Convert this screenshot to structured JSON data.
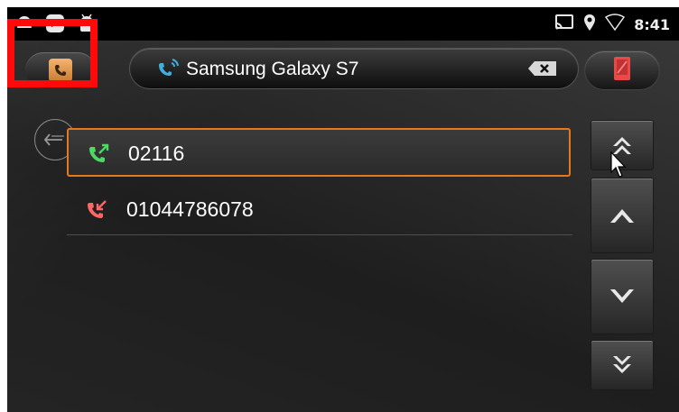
{
  "status_bar": {
    "time": "8:41",
    "left_icons": [
      "notification-icon",
      "app-icon",
      "android-icon"
    ],
    "right_icons": [
      "cast-icon",
      "location-icon",
      "wifi-icon"
    ]
  },
  "toolbar": {
    "device_name": "Samsung Galaxy S7",
    "contacts_icon": "contacts-phone-icon",
    "bluetooth_icon": "bluetooth-call-icon",
    "clear_icon": "backspace-icon",
    "phone_icon": "phone-device-icon"
  },
  "call_log": [
    {
      "number": "02116",
      "type": "outgoing",
      "selected": true
    },
    {
      "number": "01044786078",
      "type": "missed",
      "selected": false
    }
  ],
  "scroll_controls": [
    "page-up-icon",
    "up-icon",
    "down-icon",
    "page-down-icon"
  ],
  "colors": {
    "accent": "#e37b1e",
    "outgoing": "#4cd964",
    "missed": "#ff6666",
    "highlight": "#ff0a0a"
  }
}
